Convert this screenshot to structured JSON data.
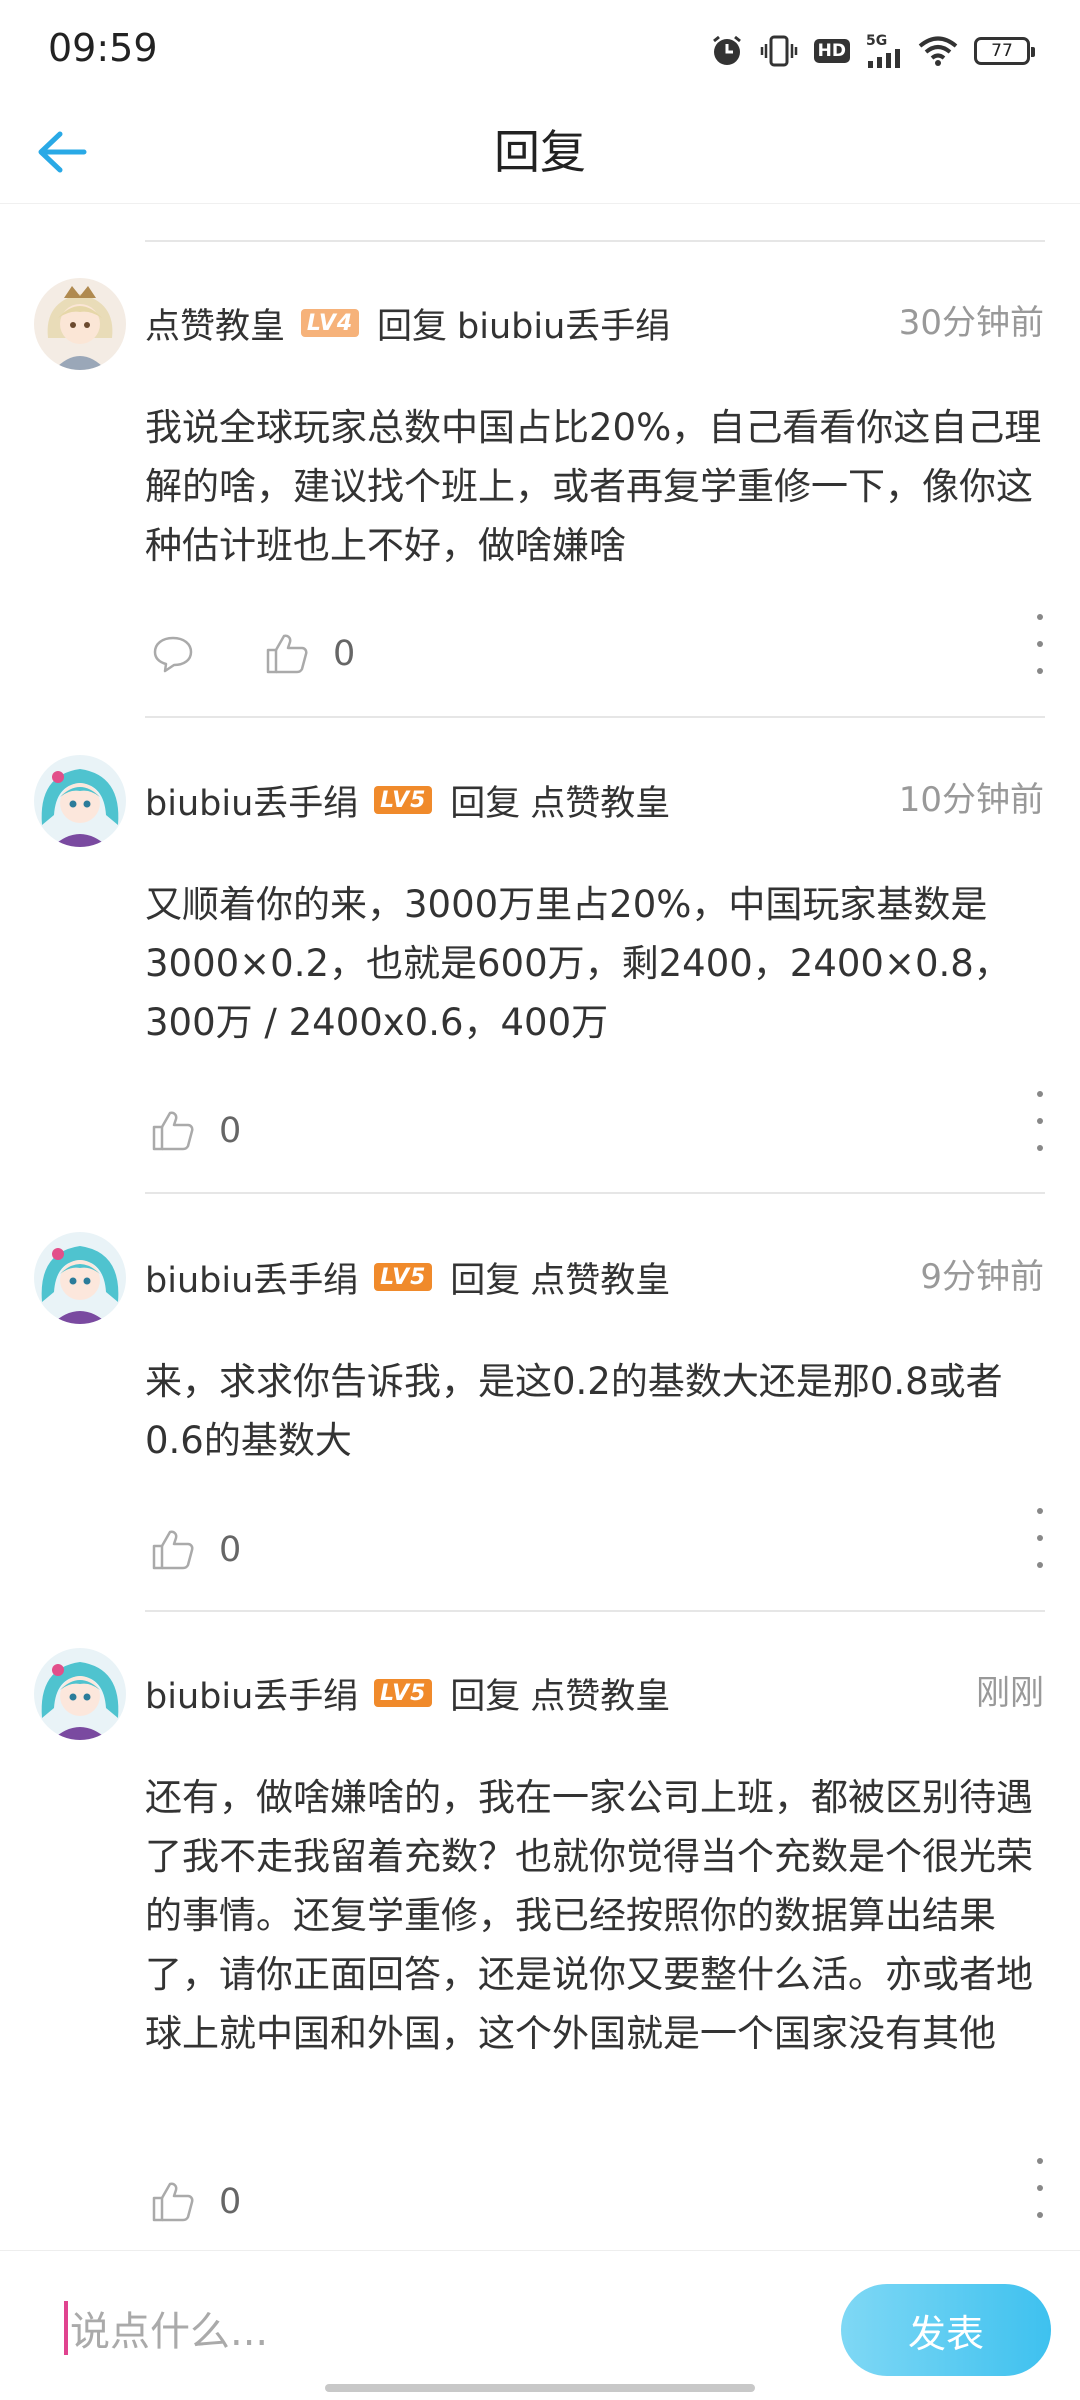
{
  "status_bar": {
    "time": "09:59",
    "network": "5G",
    "hd": "HD",
    "battery": "77"
  },
  "nav": {
    "title": "回复"
  },
  "reply_word": "回复",
  "comments": [
    {
      "author": "点赞教皇",
      "level": "LV4",
      "reply_to": "biubiu丢手绢",
      "time": "30分钟前",
      "text": "我说全球玩家总数中国占比20%，自己看看你这自己理解的啥，建议找个班上，或者再复学重修一下，像你这种估计班也上不好，做啥嫌啥",
      "likes": "0"
    },
    {
      "author": "biubiu丢手绢",
      "level": "LV5",
      "reply_to": "点赞教皇",
      "time": "10分钟前",
      "text": "又顺着你的来，3000万里占20%，中国玩家基数是3000×0.2，也就是600万，剩2400，2400×0.8，300万 / 2400x0.6，400万",
      "likes": "0"
    },
    {
      "author": "biubiu丢手绢",
      "level": "LV5",
      "reply_to": "点赞教皇",
      "time": "9分钟前",
      "text": "来，求求你告诉我，是这0.2的基数大还是那0.8或者0.6的基数大",
      "likes": "0"
    },
    {
      "author": "biubiu丢手绢",
      "level": "LV5",
      "reply_to": "点赞教皇",
      "time": "刚刚",
      "text": "还有，做啥嫌啥的，我在一家公司上班，都被区别待遇了我不走我留着充数？也就你觉得当个充数是个很光荣的事情。还复学重修，我已经按照你的数据算出结果了，请你正面回答，还是说你又要整什么活。亦或者地球上就中国和外国，这个外国就是一个国家没有其他",
      "likes": "0"
    }
  ],
  "composer": {
    "placeholder": "说点什么...",
    "send_label": "发表"
  },
  "colors": {
    "accent": "#29a9e6",
    "lv4": "#f6b27a",
    "lv5": "#f08a2b",
    "send_button": "#3ec1ef"
  }
}
